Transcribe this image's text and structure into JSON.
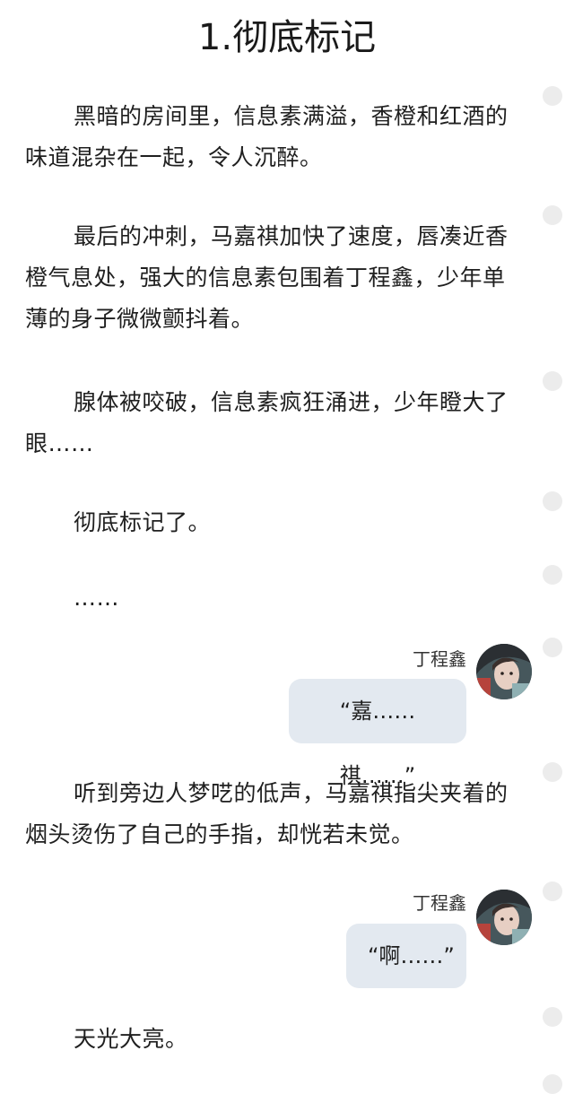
{
  "chapter": {
    "title": "1.彻底标记"
  },
  "paragraphs": [
    "黑暗的房间里，信息素满溢，香橙和红酒的味道混杂在一起，令人沉醉。",
    "最后的冲刺，马嘉祺加快了速度，唇凑近香橙气息处，强大的信息素包围着丁程鑫，少年单薄的身子微微颤抖着。",
    "腺体被咬破，信息素疯狂涌进，少年瞪大了眼……",
    "彻底标记了。",
    "……",
    "听到旁边人梦呓的低声，马嘉祺指尖夹着的烟头烫伤了自己的手指，却恍若未觉。",
    "天光大亮。"
  ],
  "chat": [
    {
      "speaker": "丁程鑫",
      "text": "“嘉……祺……”"
    },
    {
      "speaker": "丁程鑫",
      "text": "“啊……”"
    }
  ],
  "colors": {
    "bubble": "#e3e9f0",
    "comment_dot": "#ececec",
    "text": "#1f1f1f"
  },
  "icons": {
    "comment": "comment-dot-icon",
    "avatar": "avatar-image"
  }
}
